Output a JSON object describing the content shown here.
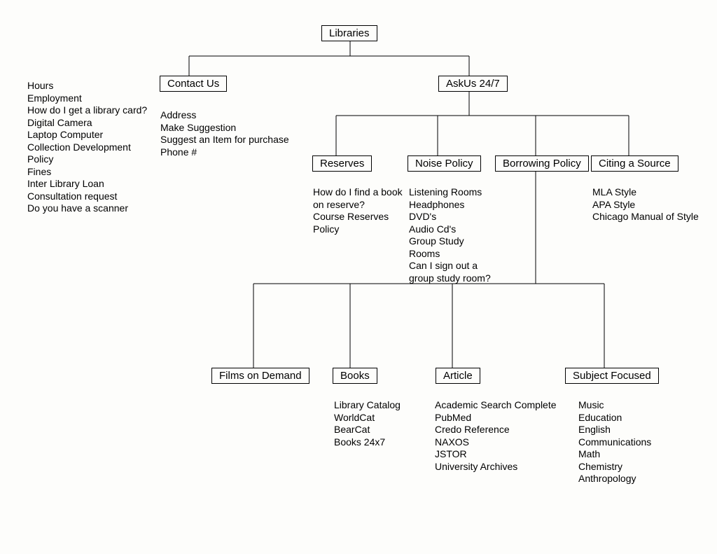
{
  "root": {
    "label": "Libraries"
  },
  "contact_us": {
    "label": "Contact Us",
    "items": [
      "Address",
      "Make Suggestion",
      "Suggest an Item for purchase",
      "Phone #"
    ]
  },
  "misc_left": {
    "items": [
      "Hours",
      "Employment",
      "How do I get a library card?",
      "Digital Camera",
      "Laptop Computer",
      "Collection Development Policy",
      "Fines",
      "Inter Library Loan",
      "Consultation request",
      "Do you have a scanner"
    ]
  },
  "askus": {
    "label": "AskUs 24/7"
  },
  "reserves": {
    "label": "Reserves",
    "items": [
      "How do I find a book on reserve?",
      "Course Reserves Policy"
    ]
  },
  "noise": {
    "label": "Noise Policy",
    "items": [
      "Listening Rooms",
      "Headphones",
      "DVD's",
      "Audio Cd's",
      "Group Study Rooms",
      "Can I sign out a group study room?"
    ]
  },
  "borrowing": {
    "label": "Borrowing Policy"
  },
  "citing": {
    "label": "Citing a Source",
    "items": [
      "MLA Style",
      "APA Style",
      "Chicago Manual of Style"
    ]
  },
  "films": {
    "label": "Films on Demand"
  },
  "books": {
    "label": "Books",
    "items": [
      "Library Catalog",
      "WorldCat",
      "BearCat",
      "Books 24x7"
    ]
  },
  "article": {
    "label": "Article",
    "items": [
      "Academic Search Complete",
      "PubMed",
      "Credo Reference",
      "NAXOS",
      "JSTOR",
      "University Archives"
    ]
  },
  "subject": {
    "label": "Subject Focused",
    "items": [
      "Music",
      "Education",
      "English",
      "Communications",
      "Math",
      "Chemistry",
      "Anthropology"
    ]
  }
}
